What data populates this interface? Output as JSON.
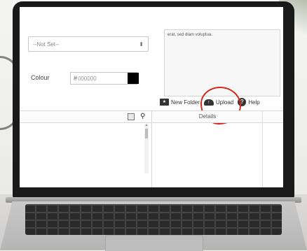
{
  "form": {
    "select_value": "--Not Set--",
    "notes_text": "erat, sed diam voluptua.",
    "colour_label": "Colour",
    "colour_hash": "#",
    "colour_value": "000000",
    "colour_swatch": "#000000"
  },
  "toolbar": {
    "new_folder_label": "New Folder",
    "upload_label": "Upload",
    "help_label": "Help"
  },
  "panel": {
    "details_label": "Details"
  },
  "icons": {
    "select_chevron": "chevron-updown-icon",
    "new_folder": "new-folder-icon",
    "upload": "cloud-upload-icon",
    "help": "help-icon",
    "split": "split-view-icon",
    "search": "search-icon"
  },
  "annotation_color": "#d42a22"
}
